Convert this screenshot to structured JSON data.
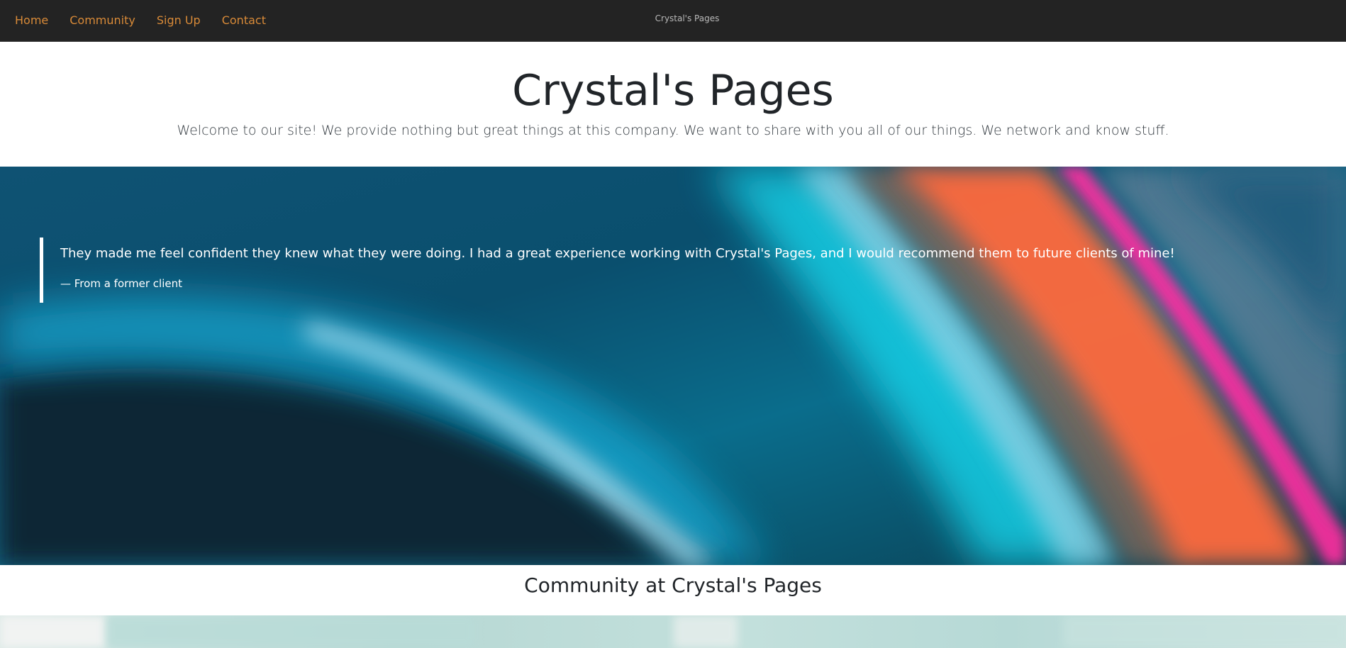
{
  "nav": {
    "links": [
      "Home",
      "Community",
      "Sign Up",
      "Contact"
    ],
    "brand": "Crystal's Pages"
  },
  "header": {
    "title": "Crystal's Pages",
    "subtitle": "Welcome to our site! We provide nothing but great things at this company. We want to share with you all of our things. We network and know stuff."
  },
  "testimonial": {
    "quote": "They made me feel confident they knew what they were doing. I had a great experience working with Crystal's Pages, and I would recommend them to future clients of mine!",
    "source": "— From a former client"
  },
  "community": {
    "title": "Community at Crystal's Pages"
  },
  "colors": {
    "navbar": "#232323",
    "nav_link": "#d88a38",
    "text_dark": "#212529"
  }
}
